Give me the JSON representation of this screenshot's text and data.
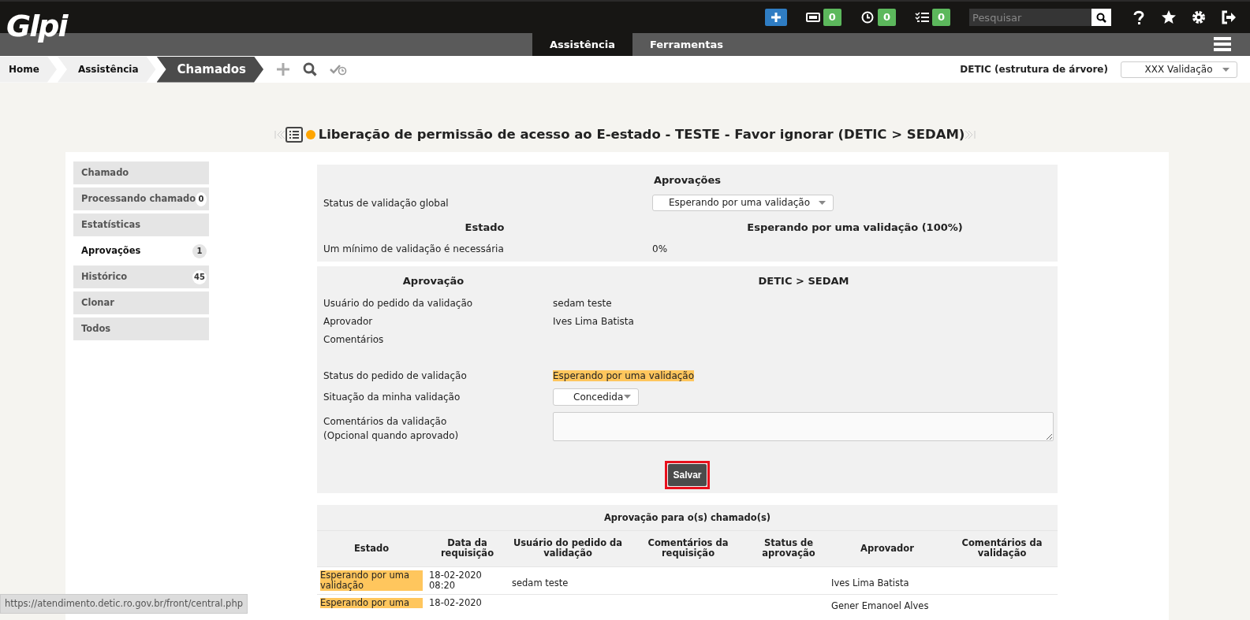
{
  "header": {
    "logo": "Glpi",
    "counters": [
      {
        "kind": "ticket",
        "count": "0"
      },
      {
        "kind": "clock",
        "count": "0"
      },
      {
        "kind": "tasks",
        "count": "0"
      }
    ],
    "search": {
      "placeholder": "Pesquisar"
    }
  },
  "menu": [
    {
      "label": "Assistência",
      "selected": true
    },
    {
      "label": "Ferramentas",
      "selected": false
    }
  ],
  "breadcrumbs": [
    {
      "label": "Home",
      "current": false
    },
    {
      "label": "Assistência",
      "current": false
    },
    {
      "label": "Chamados",
      "current": true
    }
  ],
  "entity": {
    "label": "DETIC (estrutura de árvore)",
    "profile": "XXX Validação"
  },
  "title": "Liberação de permissão de acesso ao E-estado - TESTE - Favor ignorar (DETIC > SEDAM)",
  "sidebar": {
    "items": [
      {
        "label": "Chamado",
        "selected": false
      },
      {
        "label": "Processando chamado",
        "count": "0",
        "selected": false
      },
      {
        "label": "Estatísticas",
        "selected": false
      },
      {
        "label": "Aprovações",
        "count": "1",
        "selected": true
      },
      {
        "label": "Histórico",
        "count": "45",
        "selected": false
      },
      {
        "label": "Clonar",
        "selected": false
      },
      {
        "label": "Todos",
        "selected": false
      }
    ]
  },
  "approvals": {
    "heading": "Aprovações",
    "global_label": "Status de validação global",
    "global_value": "Esperando por uma validação",
    "state_heading": "Estado",
    "state_value": "Esperando por uma validação (100%)",
    "minimum_label": "Um mínimo de validação é necessária",
    "minimum_value": "0%"
  },
  "approval": {
    "heading": "Aprovação",
    "target": "DETIC > SEDAM",
    "fields": [
      {
        "label": "Usuário do pedido da validação",
        "value": "sedam teste"
      },
      {
        "label": "Aprovador",
        "value": "Ives Lima Batista"
      },
      {
        "label": "Comentários"
      }
    ],
    "request_status_label": "Status do pedido de validação",
    "request_status": "Esperando por uma validação",
    "my_status_label": "Situação da minha validação",
    "my_status": "Concedida",
    "comment_label": "Comentários da validação",
    "comment_hint": "(Opcional quando aprovado)",
    "save": {
      "label": "Salvar",
      "highlighted": true
    }
  },
  "history": {
    "title": "Aprovação para o(s) chamado(s)",
    "columns": [
      "Estado",
      "Data da requisição",
      "Usuário do pedido da validação",
      "Comentários da requisição",
      "Status de aprovação",
      "Aprovador",
      "Comentários da validação"
    ],
    "rows": [
      [
        "Esperando por uma validação",
        "18-02-2020 08:20",
        "sedam teste",
        "",
        "",
        "Ives Lima Batista",
        ""
      ],
      [
        "Esperando por uma",
        "18-02-2020",
        "",
        "",
        "",
        "Gener Emanoel Alves",
        ""
      ]
    ]
  },
  "status_url": "https://atendimento.detic.ro.gov.br/front/central.php"
}
